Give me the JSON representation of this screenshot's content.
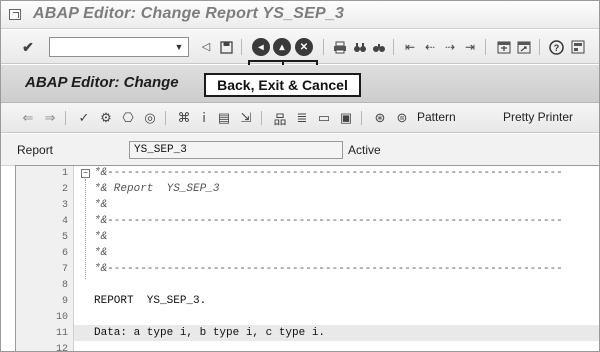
{
  "window": {
    "title": "ABAP Editor: Change Report YS_SEP_3"
  },
  "standard_toolbar": {
    "command_field_value": "",
    "icons": [
      "enter-check-icon",
      "dropdown-icon",
      "prev-icon",
      "save-icon",
      "back-icon",
      "exit-icon",
      "cancel-icon",
      "print-icon",
      "find-icon",
      "find-next-icon",
      "first-page-icon",
      "prev-page-icon",
      "next-page-icon",
      "last-page-icon",
      "create-session-icon",
      "shortcut-icon",
      "help-icon",
      "customize-icon"
    ]
  },
  "callout": {
    "label": "Back, Exit & Cancel"
  },
  "screen": {
    "title": "ABAP Editor: Change"
  },
  "app_toolbar": {
    "pattern_label": "Pattern",
    "pretty_printer_label": "Pretty Printer"
  },
  "report_row": {
    "label": "Report",
    "value": "YS_SEP_3",
    "status": "Active"
  },
  "editor": {
    "lines": [
      {
        "n": "1",
        "text": "*&---------------------------------------------------------------------",
        "comment": true
      },
      {
        "n": "2",
        "text": "*& Report  YS_SEP_3",
        "comment": true
      },
      {
        "n": "3",
        "text": "*&",
        "comment": true
      },
      {
        "n": "4",
        "text": "*&---------------------------------------------------------------------",
        "comment": true
      },
      {
        "n": "5",
        "text": "*&",
        "comment": true
      },
      {
        "n": "6",
        "text": "*&",
        "comment": true
      },
      {
        "n": "7",
        "text": "*&---------------------------------------------------------------------",
        "comment": true
      },
      {
        "n": "8",
        "text": "",
        "comment": false
      },
      {
        "n": "9",
        "text": "REPORT  YS_SEP_3.",
        "comment": false
      },
      {
        "n": "10",
        "text": "",
        "comment": false
      },
      {
        "n": "11",
        "text": "Data: a type i, b type i, c type i.",
        "comment": false
      },
      {
        "n": "12",
        "text": "",
        "comment": false
      }
    ],
    "highlighted_line": "11"
  }
}
